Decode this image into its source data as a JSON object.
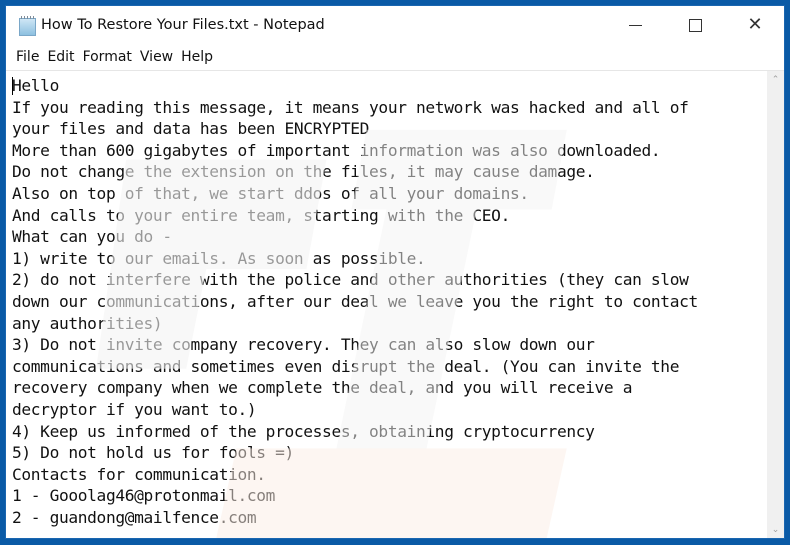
{
  "window": {
    "title": "How To Restore Your Files.txt - Notepad",
    "icon": "notepad-icon",
    "controls": {
      "minimize": "minimize-icon",
      "maximize": "maximize-icon",
      "close": "close-icon",
      "close_glyph": "✕"
    }
  },
  "menubar": {
    "items": [
      {
        "label": "File"
      },
      {
        "label": "Edit"
      },
      {
        "label": "Format"
      },
      {
        "label": "View"
      },
      {
        "label": "Help"
      }
    ]
  },
  "document": {
    "lines": [
      "Hello",
      "If you reading this message, it means your network was hacked and all of",
      "your files and data has been ENCRYPTED",
      "More than 600 gigabytes of important information was also downloaded.",
      "Do not change the extension on the files, it may cause damage.",
      "Also on top of that, we start ddos of all your domains.",
      "And calls to your entire team, starting with the CEO.",
      "What can you do -",
      "1) write to our emails. As soon as possible.",
      "2) do not interfere with the police and other authorities (they can slow",
      "down our communications, after our deal we leave you the right to contact",
      "any authorities)",
      "3) Do not invite company recovery. They can also slow down our",
      "communications and sometimes even disrupt the deal. (You can invite the",
      "recovery company when we complete the deal, and you will receive a",
      "decryptor if you want to.)",
      "4) Keep us informed of the processes, obtaining cryptocurrency",
      "5) Do not hold us for fools =)",
      "Contacts for communication.",
      "1 - Gooolag46@protonmail.com",
      "2 - guandong@mailfence.com"
    ]
  },
  "scrollbar": {
    "up_glyph": "⌃",
    "down_glyph": "⌄"
  },
  "colors": {
    "desktop": "#0a5aa6",
    "window_bg": "#ffffff",
    "text": "#111111"
  }
}
